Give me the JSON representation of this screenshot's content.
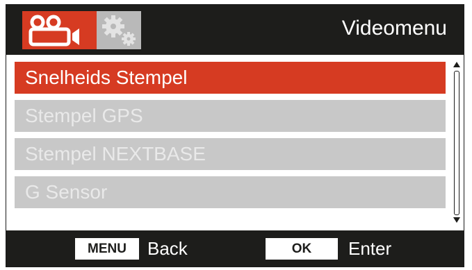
{
  "header": {
    "title": "Videomenu",
    "tabs": [
      {
        "icon": "video-camera-icon",
        "active": true
      },
      {
        "icon": "gears-icon",
        "active": false
      }
    ]
  },
  "menu": {
    "items": [
      {
        "label": "Snelheids Stempel",
        "selected": true
      },
      {
        "label": "Stempel GPS",
        "selected": false
      },
      {
        "label": "Stempel NEXTBASE",
        "selected": false
      },
      {
        "label": "G Sensor",
        "selected": false
      }
    ]
  },
  "footer": {
    "menu_key": "MENU",
    "menu_action": "Back",
    "ok_key": "OK",
    "ok_action": "Enter"
  },
  "colors": {
    "accent": "#d63b22",
    "bar": "#1d1d1b",
    "item_bg": "#c8c8c8",
    "item_text": "#e9e9e9"
  }
}
